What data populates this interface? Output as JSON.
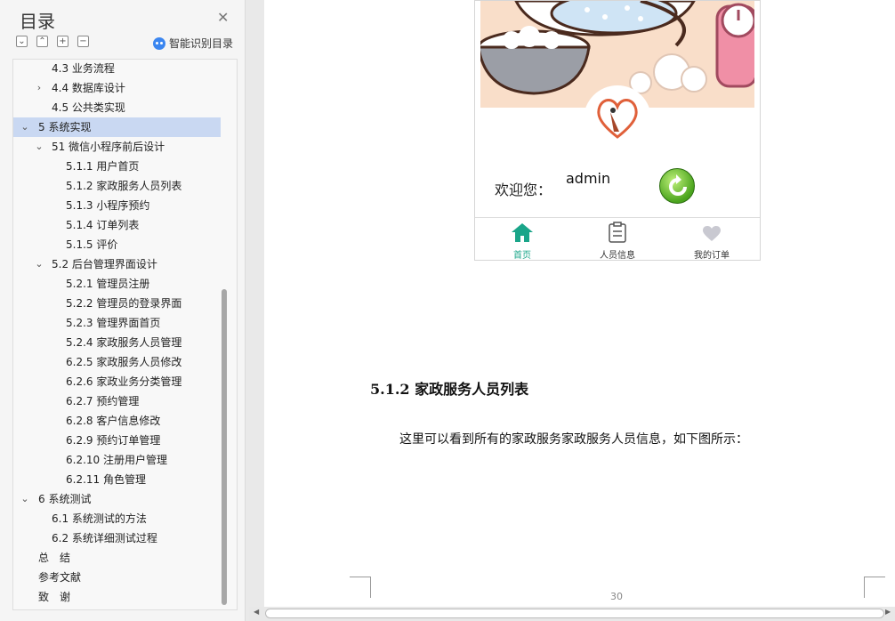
{
  "sidebar": {
    "title": "目录",
    "ai_label": "智能识别目录",
    "toc": [
      {
        "label": "4.3 业务流程",
        "level": 2,
        "caret": ""
      },
      {
        "label": "4.4 数据库设计",
        "level": 2,
        "caret": "›"
      },
      {
        "label": "4.5 公共类实现",
        "level": 2,
        "caret": ""
      },
      {
        "label": "5 系统实现",
        "level": 1,
        "caret": "⌄",
        "selected": true
      },
      {
        "label": "51 微信小程序前后设计",
        "level": 2,
        "caret": "⌄"
      },
      {
        "label": "5.1.1 用户首页",
        "level": 3,
        "caret": ""
      },
      {
        "label": "5.1.2 家政服务人员列表",
        "level": 3,
        "caret": ""
      },
      {
        "label": "5.1.3 小程序预约",
        "level": 3,
        "caret": ""
      },
      {
        "label": "5.1.4 订单列表",
        "level": 3,
        "caret": ""
      },
      {
        "label": "5.1.5 评价",
        "level": 3,
        "caret": ""
      },
      {
        "label": "5.2 后台管理界面设计",
        "level": 2,
        "caret": "⌄"
      },
      {
        "label": "5.2.1 管理员注册",
        "level": 3,
        "caret": ""
      },
      {
        "label": "5.2.2 管理员的登录界面",
        "level": 3,
        "caret": ""
      },
      {
        "label": "5.2.3 管理界面首页",
        "level": 3,
        "caret": ""
      },
      {
        "label": "5.2.4 家政服务人员管理",
        "level": 3,
        "caret": ""
      },
      {
        "label": "6.2.5 家政服务人员修改",
        "level": 3,
        "caret": ""
      },
      {
        "label": "6.2.6 家政业务分类管理",
        "level": 3,
        "caret": ""
      },
      {
        "label": "6.2.7 预约管理",
        "level": 3,
        "caret": ""
      },
      {
        "label": "6.2.8 客户信息修改",
        "level": 3,
        "caret": ""
      },
      {
        "label": "6.2.9 预约订单管理",
        "level": 3,
        "caret": ""
      },
      {
        "label": "6.2.10 注册用户管理",
        "level": 3,
        "caret": ""
      },
      {
        "label": "6.2.11 角色管理",
        "level": 3,
        "caret": ""
      },
      {
        "label": "6 系统测试",
        "level": 1,
        "caret": "⌄"
      },
      {
        "label": "6.1 系统测试的方法",
        "level": 2,
        "caret": ""
      },
      {
        "label": "6.2 系统详细测试过程",
        "level": 2,
        "caret": ""
      },
      {
        "label": "总　结",
        "level": 1,
        "caret": ""
      },
      {
        "label": "参考文献",
        "level": 1,
        "caret": ""
      },
      {
        "label": "致　谢",
        "level": 1,
        "caret": ""
      }
    ]
  },
  "phone": {
    "welcome": "欢迎您：",
    "username": "admin",
    "tabs": [
      {
        "label": "首页",
        "icon": "home-icon",
        "active": true
      },
      {
        "label": "人员信息",
        "icon": "clipboard-icon",
        "active": false
      },
      {
        "label": "我的订单",
        "icon": "heart-icon",
        "active": false
      }
    ]
  },
  "document": {
    "heading": "5.1.2 家政服务人员列表",
    "paragraph": "这里可以看到所有的家政服务家政服务人员信息，如下图所示：",
    "page_number": "30"
  },
  "colors": {
    "selected_bg": "#c9d8f2",
    "active_tab": "#1aa589",
    "accent_blue": "#3b86f0"
  }
}
